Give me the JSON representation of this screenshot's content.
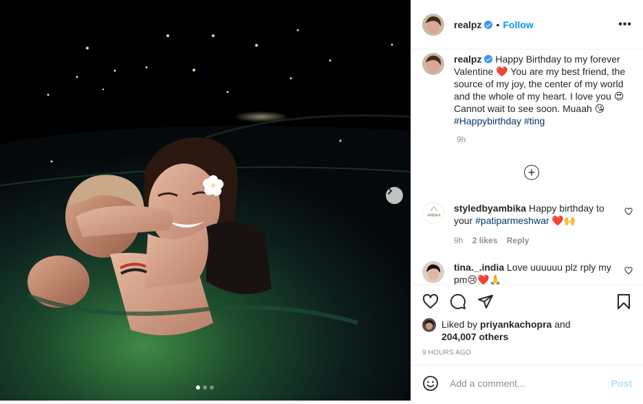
{
  "post": {
    "username": "realpz",
    "follow_label": "Follow",
    "separator": "•",
    "more_label": "•••"
  },
  "caption": {
    "username": "realpz",
    "text_1": "Happy Birthday to my forever Valentine ❤️ You are my best friend, the source of my joy, the center of my world and the whole of my heart. I love you 😍 Cannot wait to see soon. Muaah 😘 ",
    "hashtag_1": "#Happybirthday",
    "hashtag_2": "#ting",
    "time": "9h"
  },
  "load_more_label": "+",
  "comments": [
    {
      "username": "styledbyambika",
      "text": "Happy birthday to your ",
      "hashtag": "#patiparmeshwar",
      "emoji": " ❤️🙌",
      "time": "9h",
      "likes": "2 likes",
      "reply": "Reply",
      "avatar_text": "AMBIKA"
    },
    {
      "username": "tina._.india",
      "text": "Love uuuuuu plz rply my pm😢❤️🙏"
    }
  ],
  "actions": {
    "liked_by_prefix": "Liked by",
    "liked_by_user": "priyankachopra",
    "and": "and",
    "others": "204,007 others",
    "time_ago": "9 HOURS AGO"
  },
  "add_comment": {
    "placeholder": "Add a comment...",
    "post_label": "Post"
  },
  "carousel": {
    "total": 3,
    "active": 1
  },
  "colors": {
    "accent": "#0095f6",
    "hashtag": "#00376b",
    "muted": "#8e8e8e",
    "post_disabled": "#b2dffc",
    "verified": "#3897f0"
  }
}
